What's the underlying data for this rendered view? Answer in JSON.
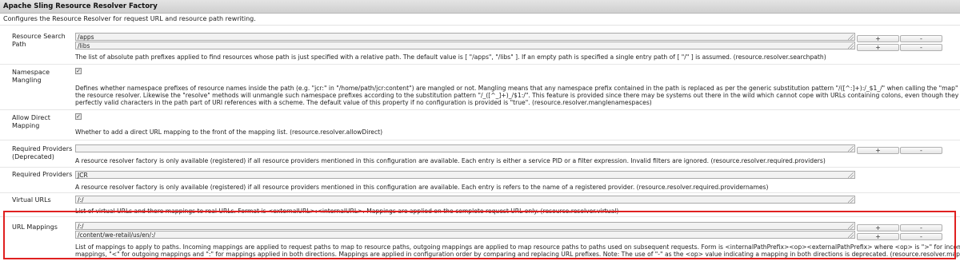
{
  "title": "Apache Sling Resource Resolver Factory",
  "subtitle": "Configures the Resource Resolver for request URL and resource path rewriting.",
  "buttons": {
    "plus": "+",
    "minus": "-"
  },
  "search_path": {
    "label": "Resource Search Path",
    "values": [
      "/apps",
      "/libs"
    ],
    "description": "The list of absolute path prefixes applied to find resources whose path is just specified with a relative path. The default value is [ \"/apps\", \"/libs\" ]. If an empty path is specified a single entry path of [ \"/\" ] is assumed. (resource.resolver.searchpath)"
  },
  "namespace": {
    "label": "Namespace Mangling",
    "checked": "✓",
    "description1": "Defines whether namespace prefixes of resource names inside the path (e.g. \"jcr:\" in \"/home/path/jcr:content\") are mangled or not. Mangling means that any namespace prefix contained in the path is replaced as per the generic substitution pattern \"/([^:]+):/_$1_/\" when calling the \"map\" method of",
    "description2": "the resource resolver. Likewise the \"resolve\" methods will unmangle such namespace prefixes according to the substitution pattern \"/_([^_]+)_/$1:/\". This feature is provided since there may be systems out there in the wild which cannot cope with URLs containing colons, even though they are",
    "description3": "perfectly valid characters in the path part of URI references with a scheme. The default value of this property if no configuration is provided is \"true\". (resource.resolver.manglenamespaces)"
  },
  "direct": {
    "label": "Allow Direct Mapping",
    "checked": "✓",
    "description": "Whether to add a direct URL mapping to the front of the mapping list. (resource.resolver.allowDirect)"
  },
  "required_deprecated": {
    "label": "Required Providers (Deprecated)",
    "value": "",
    "description": "A resource resolver factory is only available (registered) if all resource providers mentioned in this configuration are available. Each entry is either a service PID or a filter expression. Invalid filters are ignored. (resource.resolver.required.providers)"
  },
  "required": {
    "label": "Required Providers",
    "value": "JCR",
    "description": "A resource resolver factory is only available (registered) if all resource providers mentioned in this configuration are available. Each entry is refers to the name of a registered provider. (resource.resolver.required.providernames)"
  },
  "virtual": {
    "label": "Virtual URLs",
    "value": "/:/",
    "description": "List of virtual URLs and there mappings to real URLs. Format is <externalURL>:<internalURL>. Mappings are applied on the complete request URL only. (resource.resolver.virtual)"
  },
  "mappings": {
    "label": "URL Mappings",
    "values": [
      "/:/",
      "/content/we-retail/us/en/:/"
    ],
    "description1": "List of mappings to apply to paths. Incoming mappings are applied to request paths to map to resource paths, outgoing mappings are applied to map resource paths to paths used on subsequent requests. Form is <internalPathPrefix><op><externalPathPrefix> where <op> is \">\" for incoming",
    "description2": "mappings, \"<\" for outgoing mappings and \":\" for mappings applied in both directions. Mappings are applied in configuration order by comparing and replacing URL prefixes. Note: The use of \"-\" as the <op> value indicating a mapping in both directions is deprecated. (resource.resolver.mapping)"
  }
}
